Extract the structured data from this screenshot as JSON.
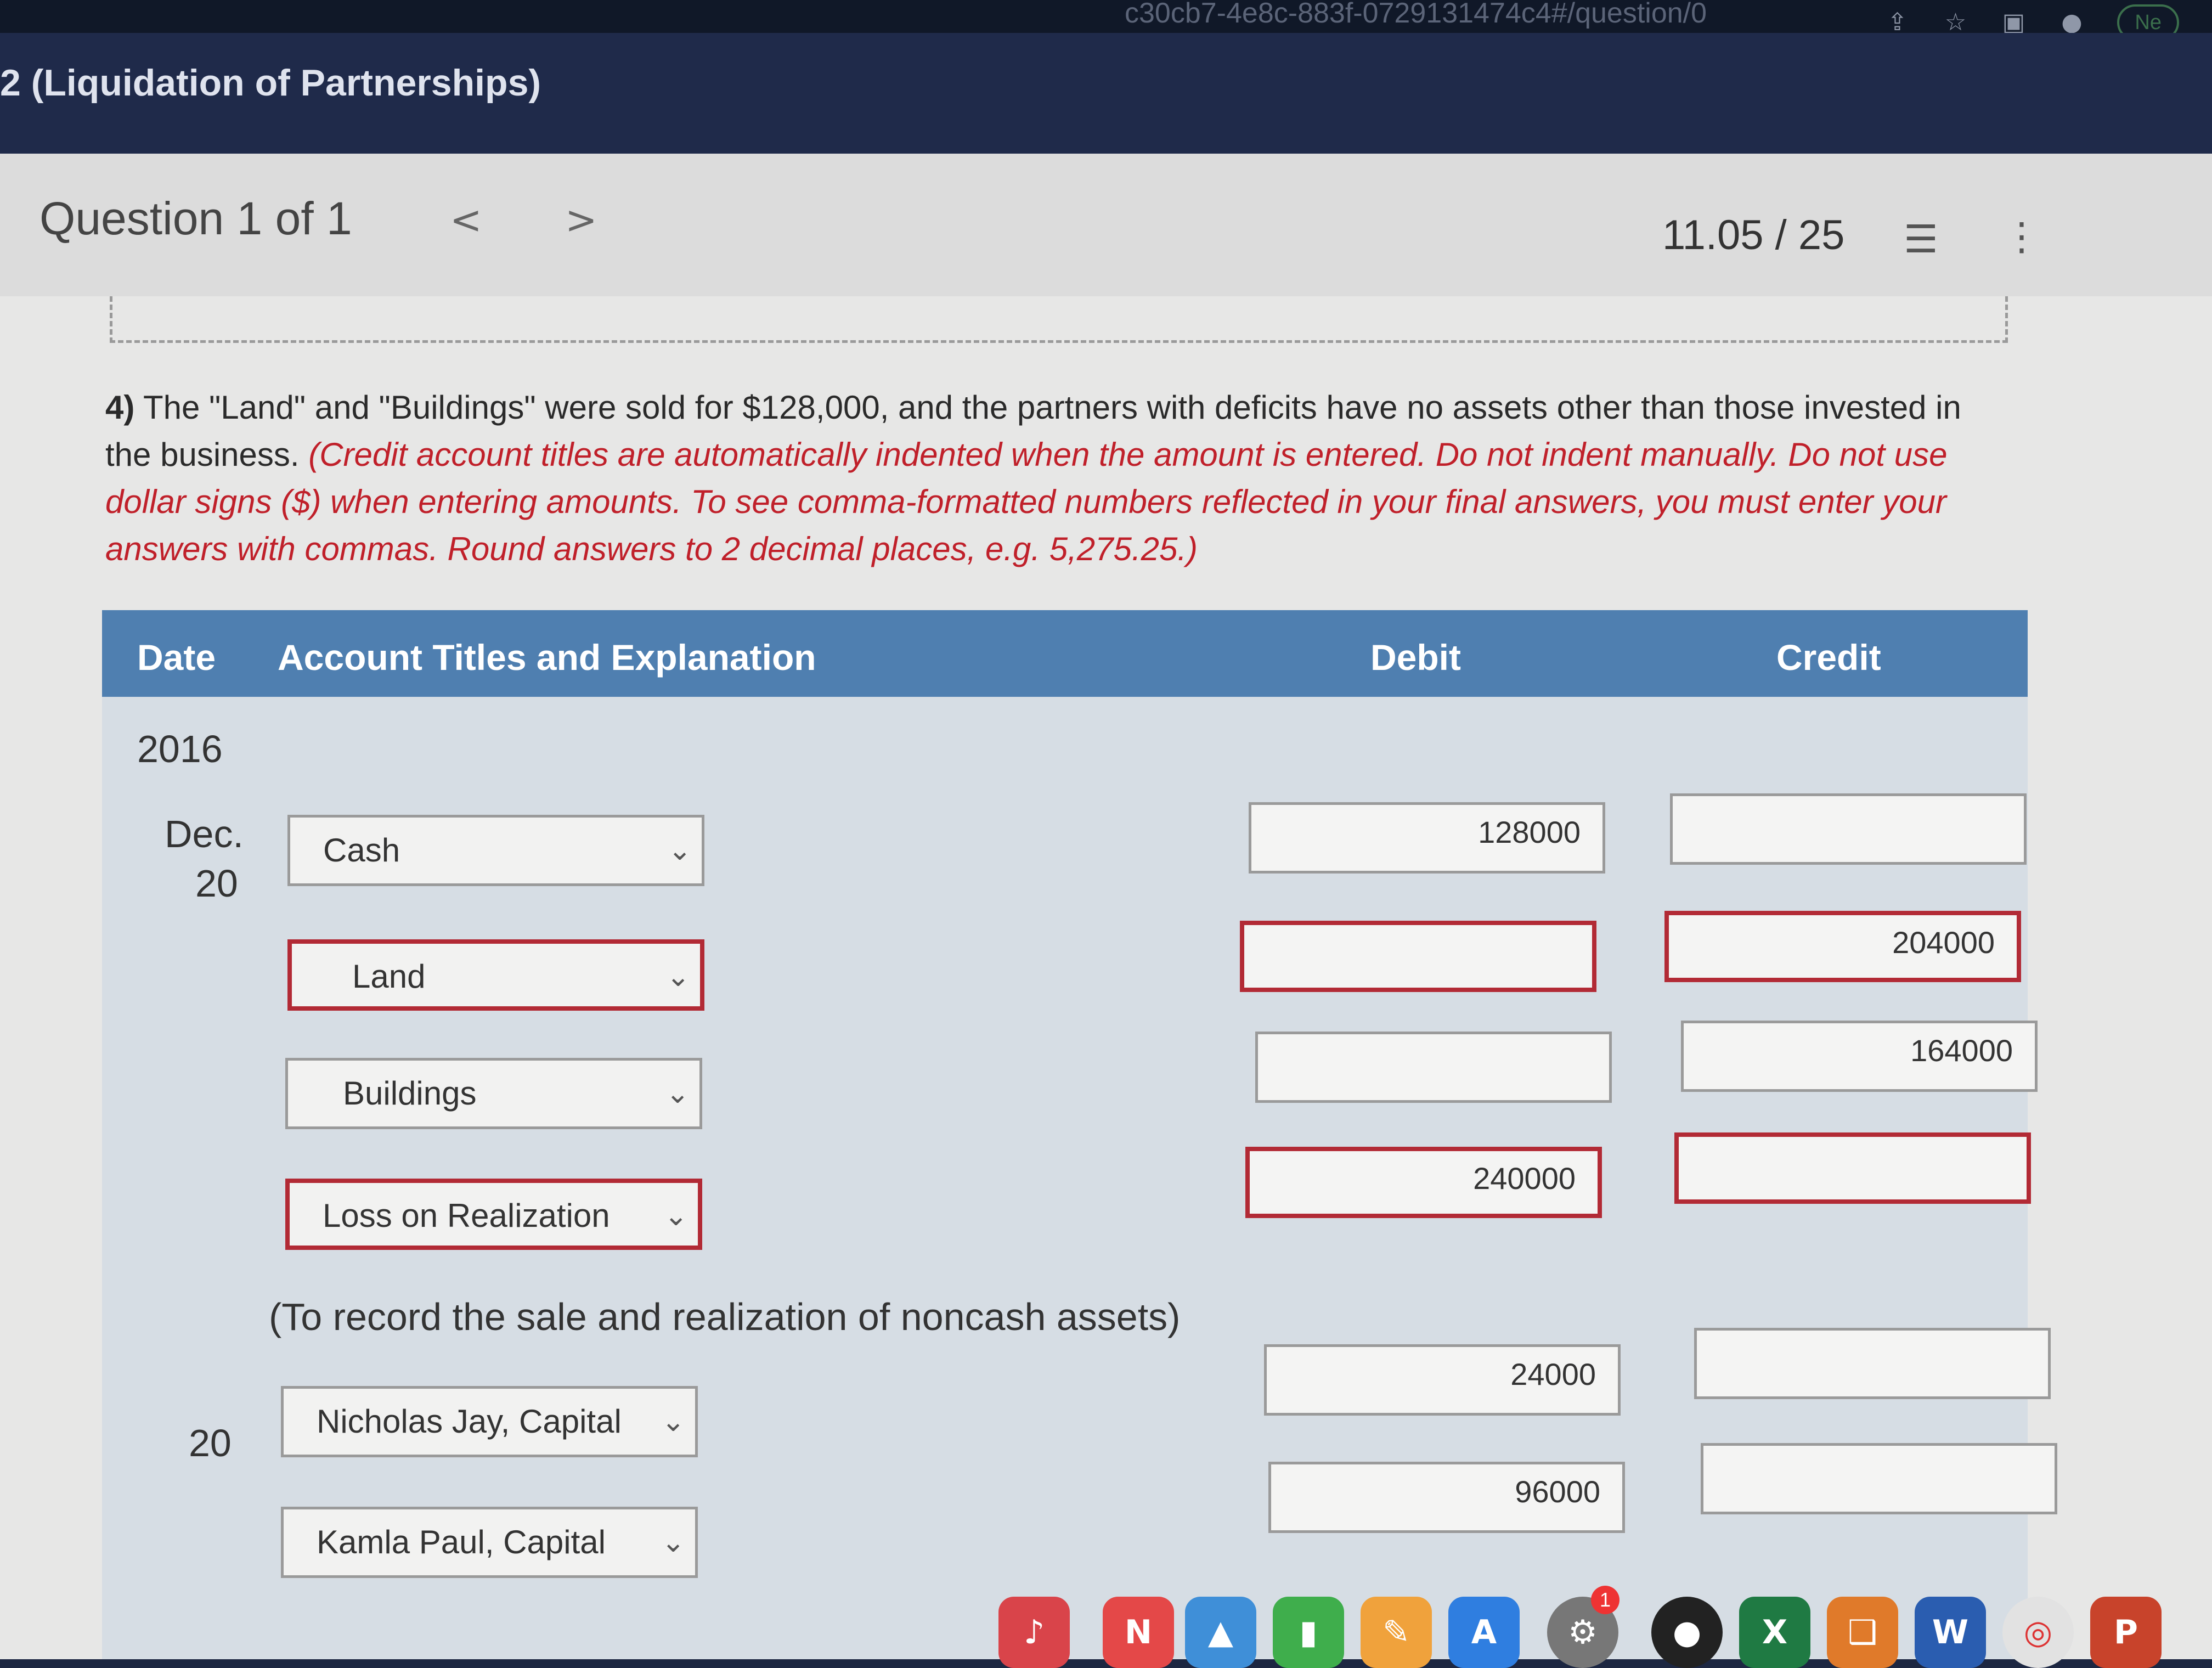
{
  "browser": {
    "url_fragment": "c30cb7-4e8c-883f-0729131474c4#/question/0",
    "new_button": "Ne",
    "icons": [
      "share-icon",
      "star-icon",
      "sidebar-icon",
      "profile-icon"
    ]
  },
  "header": {
    "course_title": "2 (Liquidation of Partnerships)"
  },
  "question_bar": {
    "label": "Question 1 of 1",
    "prev": "<",
    "next": ">",
    "score": "11.05 / 25",
    "list_icon": "☰",
    "more_icon": "⋮"
  },
  "problem": {
    "number": "4)",
    "text": "The \"Land\" and \"Buildings\" were sold for $128,000, and the partners with deficits have no assets other than those invested in the business.",
    "instructions": "(Credit account titles are automatically indented when the amount is entered. Do not indent manually. Do not use dollar signs ($) when entering amounts. To see comma-formatted numbers reflected in your final answers, you must enter your answers with commas. Round answers to 2 decimal places, e.g. 5,275.25.)"
  },
  "table": {
    "headers": {
      "date": "Date",
      "account": "Account Titles and Explanation",
      "debit": "Debit",
      "credit": "Credit"
    },
    "year": "2016",
    "entry1": {
      "month": "Dec.",
      "day": "20",
      "rows": [
        {
          "account": "Cash",
          "debit": "128000",
          "credit": ""
        },
        {
          "account": "Land",
          "debit": "",
          "credit": "204000"
        },
        {
          "account": "Buildings",
          "debit": "",
          "credit": "164000"
        },
        {
          "account": "Loss on Realization",
          "debit": "240000",
          "credit": ""
        }
      ],
      "explanation": "(To record the sale and realization of noncash assets)"
    },
    "entry2": {
      "day": "20",
      "rows": [
        {
          "account": "Nicholas Jay, Capital",
          "debit": "24000",
          "credit": ""
        },
        {
          "account": "Kamla Paul, Capital",
          "debit": "96000",
          "credit": ""
        }
      ]
    }
  },
  "dock": {
    "badge": "1",
    "excel_label": "X",
    "word_label": "W",
    "ppt_label": "P"
  },
  "colors": {
    "header_navy": "#1f2a4a",
    "table_header_blue": "#4f7fb0",
    "instruction_red": "#c0202a",
    "error_border": "#b22a35"
  }
}
